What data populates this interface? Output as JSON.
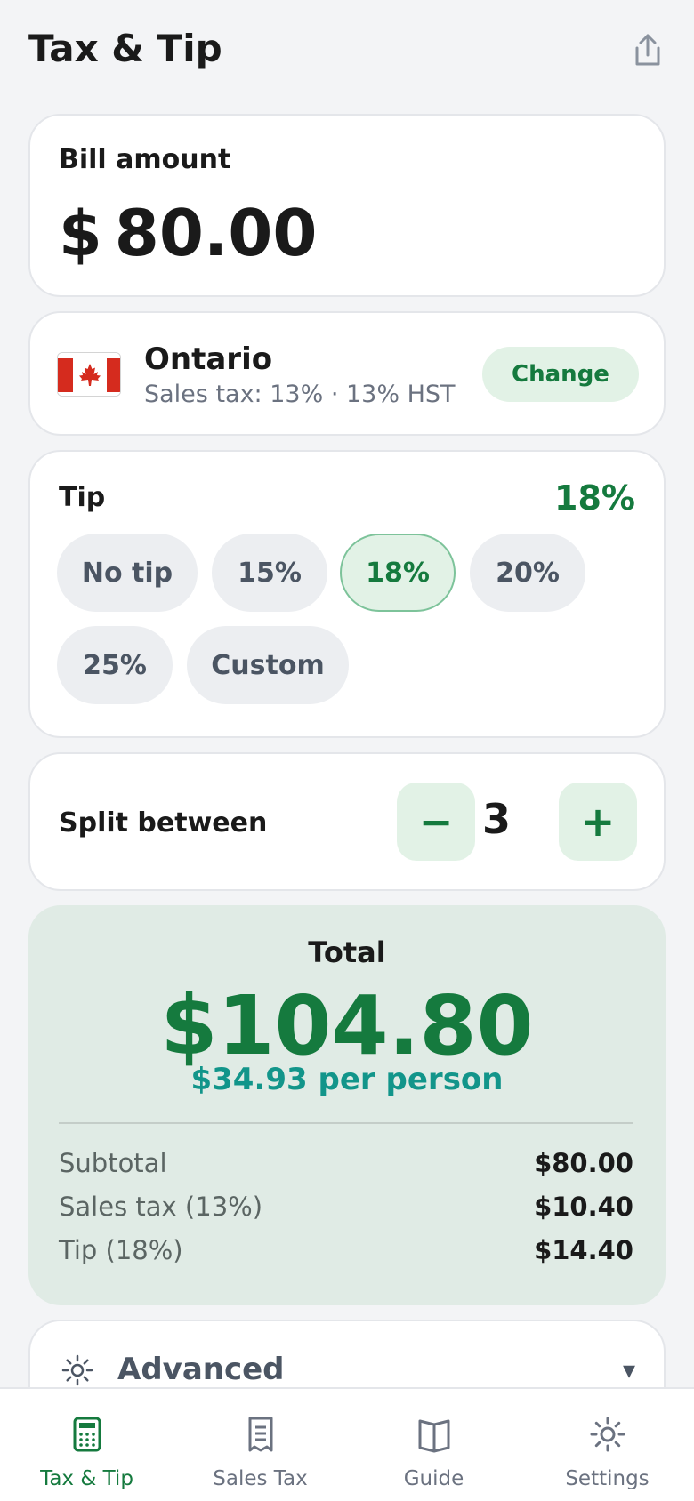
{
  "header": {
    "title": "Tax & Tip",
    "share_icon": "share-icon"
  },
  "bill": {
    "label": "Bill amount",
    "currency": "$",
    "amount": "80.00"
  },
  "region": {
    "name": "Ontario",
    "subtitle": "Sales tax: 13% · 13% HST",
    "change_label": "Change",
    "flag_icon": "canada-flag-icon"
  },
  "tip": {
    "label": "Tip",
    "current": "18%",
    "options": [
      "No tip",
      "15%",
      "18%",
      "20%",
      "25%",
      "Custom"
    ],
    "selected": "18%"
  },
  "split": {
    "label": "Split between",
    "count": "3",
    "minus": "−",
    "plus": "+"
  },
  "total": {
    "label": "Total",
    "amount": "$104.80",
    "per_person": "$34.93 per person",
    "breakdown": [
      {
        "label": "Subtotal",
        "value": "$80.00"
      },
      {
        "label": "Sales tax (13%)",
        "value": "$10.40"
      },
      {
        "label": "Tip (18%)",
        "value": "$14.40"
      }
    ]
  },
  "advanced": {
    "label": "Advanced",
    "caret": "▾",
    "icon": "gear-icon"
  },
  "nav": {
    "items": [
      {
        "label": "Tax & Tip",
        "icon": "calculator-icon",
        "active": true
      },
      {
        "label": "Sales Tax",
        "icon": "receipt-icon",
        "active": false
      },
      {
        "label": "Guide",
        "icon": "book-icon",
        "active": false
      },
      {
        "label": "Settings",
        "icon": "gear-icon",
        "active": false
      }
    ]
  },
  "colors": {
    "accent": "#157a3e",
    "accent_light": "#e2f2e6",
    "per_person": "#12958a",
    "background": "#f3f4f6",
    "total_card": "#e0ebe5"
  }
}
